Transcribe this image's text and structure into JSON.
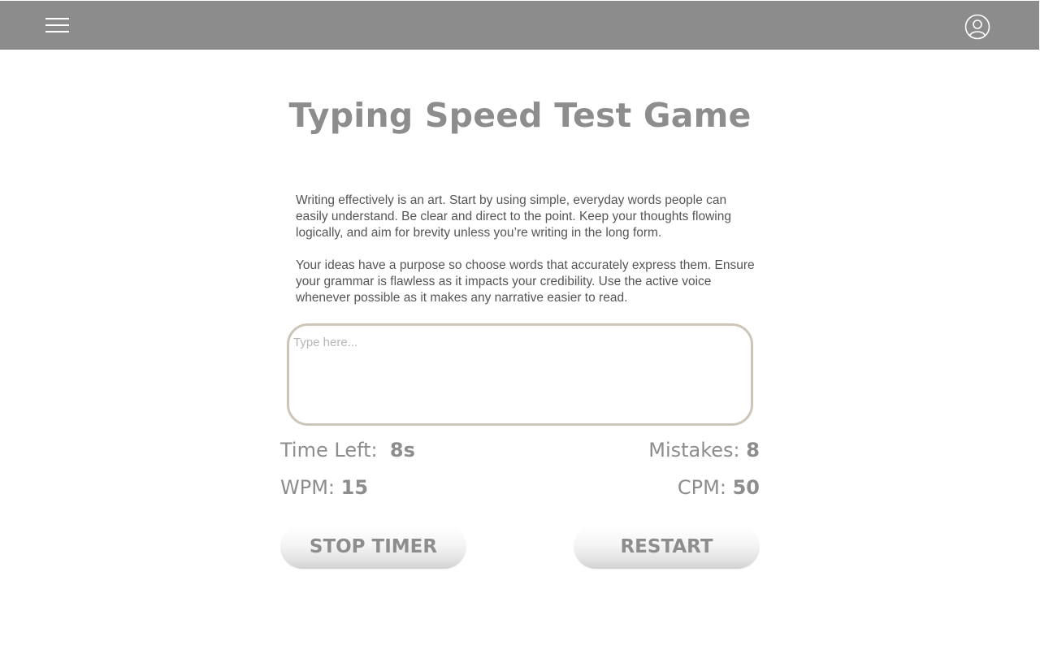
{
  "header": {
    "menu_icon": "hamburger-menu-icon",
    "profile_icon": "user-circle-icon",
    "bar_color": "#8c8c8c"
  },
  "main": {
    "title": "Typing Speed Test Game",
    "passage": [
      "Writing effectively is an art. Start by using simple, everyday words people can easily understand. Be clear and direct to the point. Keep your thoughts flowing logically, and aim for brevity unless you’re writing in the long form.",
      "Your ideas have a purpose so choose words that accurately express them. Ensure your grammar is flawless as it impacts your credibility. Use the active voice whenever possible as it makes any narrative easier to read."
    ],
    "input": {
      "placeholder": "Type here...",
      "value": ""
    },
    "stats": {
      "time_left_label": "Time Left:",
      "time_left_value": "8s",
      "mistakes_label": "Mistakes:",
      "mistakes_value": "8",
      "wpm_label": "WPM:",
      "wpm_value": "15",
      "cpm_label": "CPM:",
      "cpm_value": "50"
    },
    "buttons": {
      "stop_timer": "STOP TIMER",
      "restart": "RESTART"
    }
  }
}
